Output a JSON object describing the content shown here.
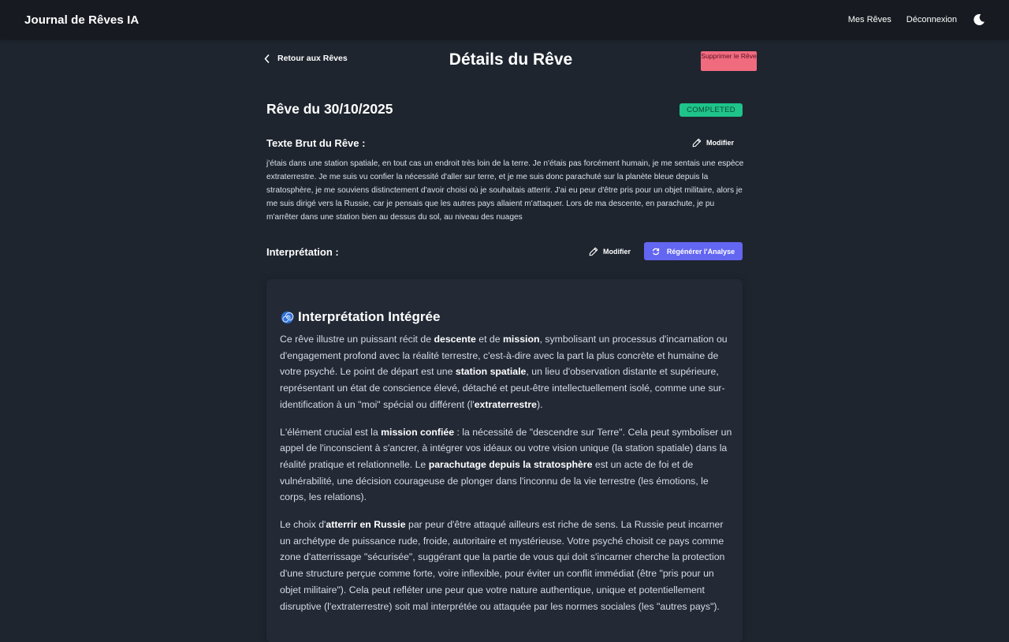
{
  "app": {
    "title": "Journal de Rêves IA",
    "nav": {
      "dreams": "Mes Rêves",
      "logout": "Déconnexion"
    }
  },
  "header": {
    "back_label": "Retour aux Rêves",
    "title": "Détails du Rêve",
    "delete_label": "Supprimer le Rêve"
  },
  "dream": {
    "heading": "Rêve du 30/10/2025",
    "status": "COMPLETED",
    "raw_label": "Texte Brut du Rêve :",
    "raw_text": "j'étais dans une station spatiale, en tout cas un endroit très loin de la terre. Je n'étais pas forcément humain, je me sentais une espèce extraterrestre. Je me suis vu confier la nécessité d'aller sur terre, et je me suis donc parachuté sur la planète bleue depuis la stratosphère, je me souviens distinctement d'avoir choisi où je souhaitais atterrir. J'ai eu peur d'être pris pour un objet militaire, alors je me suis dirigé vers la Russie, car je pensais que les autres pays allaient m'attaquer. Lors de ma descente, en parachute, je pu m'arrêter dans une station bien au dessus du sol, au niveau des nuages",
    "edit_label": "Modifier"
  },
  "interpretation": {
    "label": "Interprétation :",
    "edit_label": "Modifier",
    "regen_label": "Régénérer l'Analyse",
    "card_title": "Interprétation Intégrée",
    "p1": [
      "Ce rêve illustre un puissant récit de ",
      "descente",
      " et de ",
      "mission",
      ", symbolisant un processus d'incarnation ou d'engagement profond avec la réalité terrestre, c'est-à-dire avec la part la plus concrète et humaine de votre psyché. Le point de départ est une ",
      "station spatiale",
      ", un lieu d'observation distante et supérieure, représentant un état de conscience élevé, détaché et peut-être intellectuellement isolé, comme une sur-identification à un \"moi\" spécial ou différent (l'",
      "extraterrestre",
      ")."
    ],
    "p2": [
      "L'élément crucial est la ",
      "mission confiée",
      " : la nécessité de \"descendre sur Terre\". Cela peut symboliser un appel de l'inconscient à s'ancrer, à intégrer vos idéaux ou votre vision unique (la station spatiale) dans la réalité pratique et relationnelle. Le ",
      "parachutage depuis la stratosphère",
      " est un acte de foi et de vulnérabilité, une décision courageuse de plonger dans l'inconnu de la vie terrestre (les émotions, le corps, les relations)."
    ],
    "p3": [
      "Le choix d'",
      "atterrir en Russie",
      " par peur d'être attaqué ailleurs est riche de sens. La Russie peut incarner un  archétype de puissance rude, froide, autoritaire et mystérieuse. Votre psyché choisit ce pays comme zone d'atterrissage \"sécurisée\", suggérant que la partie de vous qui doit s'incarner cherche la protection d'une structure perçue comme forte, voire inflexible, pour éviter un conflit immédiat (être \"pris pour un objet militaire\"). Cela peut refléter une peur que votre nature authentique, unique et potentiellement disruptive (l'extraterrestre) soit mal interprétée ou attaquée par les normes sociales (les \"autres pays\")."
    ]
  },
  "icons": {
    "theme": "moon-icon",
    "back": "chevron-left-icon",
    "edit": "pencil-icon",
    "regen": "refresh-icon",
    "card": "spiral-icon"
  },
  "colors": {
    "background": "#1e252f",
    "topbar": "#171b21",
    "card": "#232a36",
    "accent": "#6366f1",
    "delete": "#f16b7f",
    "status": "#1ec48a"
  }
}
